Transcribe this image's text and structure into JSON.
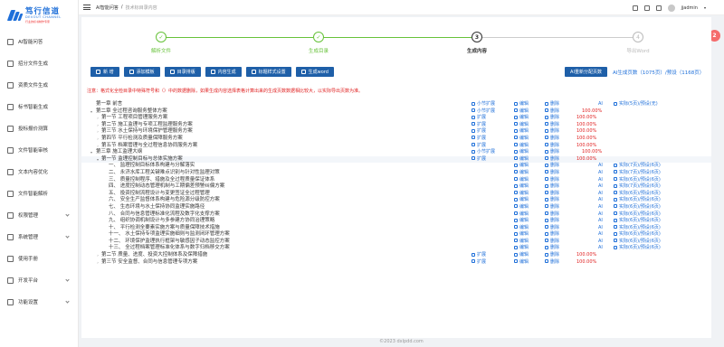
{
  "sidebar": {
    "logo": {
      "cn": "笃行信道",
      "en": "DEVOUT CHANNEL",
      "sub": "行业的标书制作专家"
    },
    "items": [
      {
        "label": "AI智能问答",
        "expand": false
      },
      {
        "label": "招分文件生成",
        "expand": false
      },
      {
        "label": "资质文件生成",
        "expand": false
      },
      {
        "label": "标书智能生成",
        "expand": false
      },
      {
        "label": "投标报价测算",
        "expand": false
      },
      {
        "label": "文件智能审核",
        "expand": false
      },
      {
        "label": "文本内容优化",
        "expand": false
      },
      {
        "label": "文件智能解析",
        "expand": false
      },
      {
        "label": "权限管理",
        "expand": true
      },
      {
        "label": "系统管理",
        "expand": true
      },
      {
        "label": "使用手册",
        "expand": false
      },
      {
        "label": "开发平台",
        "expand": true
      },
      {
        "label": "功能设置",
        "expand": true
      }
    ]
  },
  "topbar": {
    "breadcrumb": [
      "AI智能问答",
      "技术标目录内容"
    ],
    "username": "jjadmin",
    "corner_badge": "2"
  },
  "steps": [
    {
      "num": "✓",
      "label": "解析文件",
      "state": "done"
    },
    {
      "num": "✓",
      "label": "生成目录",
      "state": "done"
    },
    {
      "num": "3",
      "label": "生成内容",
      "state": "cur"
    },
    {
      "num": "4",
      "label": "导出Word",
      "state": "todo"
    }
  ],
  "toolbar": {
    "buttons": [
      "新 增",
      "添加模板",
      "目录排版",
      "内容生成",
      "标题样式设置",
      "生成word"
    ],
    "pages_button": "AI重新分配页数",
    "page_count": "AI生成页数（1075页）/预设（1168页）"
  },
  "notice": "注意：格式化全检目录中特殊符号和（）中的数据删除，如果生成内容选择表格计算出来的生成页数数据相比较大，以实际导出页数为准。",
  "labels": {
    "sub_expand": "小节扩展",
    "expand": "扩展",
    "edit": "编辑",
    "delete": "删除",
    "ai": "AI"
  },
  "tree": [
    {
      "text": "第一章 前言",
      "lvl": 0,
      "tog": "",
      "ops": "sub",
      "ai": true,
      "pct": "",
      "link": "实际(5页)/预设(无)"
    },
    {
      "text": "第二章 全过程咨询服务整体方案",
      "lvl": 0,
      "tog": "▾",
      "ops": "sub",
      "ai": false,
      "pct": "100.00%",
      "link": ""
    },
    {
      "text": "第一节 工程项目管理服务方案",
      "lvl": 1,
      "tog": "›",
      "ops": "exp",
      "ai": false,
      "pct": "100.00%",
      "link": ""
    },
    {
      "text": "第二节 施工监理与专项工程监理服务方案",
      "lvl": 1,
      "tog": "›",
      "ops": "exp",
      "ai": false,
      "pct": "100.00%",
      "link": ""
    },
    {
      "text": "第三节 水土保持与环境保护管理服务方案",
      "lvl": 1,
      "tog": "›",
      "ops": "exp",
      "ai": false,
      "pct": "100.00%",
      "link": ""
    },
    {
      "text": "第四节 平行检测及质量保障服务方案",
      "lvl": 1,
      "tog": "›",
      "ops": "exp",
      "ai": false,
      "pct": "100.00%",
      "link": ""
    },
    {
      "text": "第五节 档案管理与全过程信息协同服务方案",
      "lvl": 1,
      "tog": "›",
      "ops": "exp",
      "ai": false,
      "pct": "100.00%",
      "link": ""
    },
    {
      "text": "第三章 施工监理大纲",
      "lvl": 0,
      "tog": "▾",
      "ops": "sub",
      "ai": false,
      "pct": "100.00%",
      "link": ""
    },
    {
      "text": "第一节 监理控制目标与总体实施方案",
      "lvl": 1,
      "tog": "▾",
      "ops": "exp",
      "ai": false,
      "pct": "100.00%",
      "link": "",
      "hl": true
    },
    {
      "text": "一、 监理控制目标体系构建与分解落实",
      "lvl": 2,
      "tog": "",
      "ops": "none",
      "ai": true,
      "pct": "",
      "link": "实际(7页)/预设(6页)"
    },
    {
      "text": "二、 永济水库工程关键难点识别与针对性监理对策",
      "lvl": 2,
      "tog": "",
      "ops": "none",
      "ai": true,
      "pct": "",
      "link": "实际(7页)/预设(6页)"
    },
    {
      "text": "三、 质量控制程序、措施及全过程质量保证体系",
      "lvl": 2,
      "tog": "",
      "ops": "none",
      "ai": true,
      "pct": "",
      "link": "实际(6页)/预设(6页)"
    },
    {
      "text": "四、 进度控制动态管理机制与工期偏差预警纠偏方案",
      "lvl": 2,
      "tog": "",
      "ops": "none",
      "ai": true,
      "pct": "",
      "link": "实际(7页)/预设(6页)"
    },
    {
      "text": "五、 投资控制流程设计与变更签证全过程管理",
      "lvl": 2,
      "tog": "",
      "ops": "none",
      "ai": true,
      "pct": "",
      "link": "实际(6页)/预设(6页)"
    },
    {
      "text": "六、 安全生产监督体系构建与危险源分级防控方案",
      "lvl": 2,
      "tog": "",
      "ops": "none",
      "ai": true,
      "pct": "",
      "link": "实际(6页)/预设(6页)"
    },
    {
      "text": "七、 生态环境与水土保持协同监理实施路径",
      "lvl": 2,
      "tog": "",
      "ops": "none",
      "ai": true,
      "pct": "",
      "link": "实际(6页)/预设(6页)"
    },
    {
      "text": "八、 合同与信息管理标准化流程及数字化支撑方案",
      "lvl": 2,
      "tog": "",
      "ops": "none",
      "ai": true,
      "pct": "",
      "link": "实际(6页)/预设(6页)"
    },
    {
      "text": "九、 组织协调机制设计与多参建方协同治理策略",
      "lvl": 2,
      "tog": "",
      "ops": "none",
      "ai": true,
      "pct": "",
      "link": "实际(6页)/预设(6页)"
    },
    {
      "text": "十、 平行检测全要素实施方案与质量保障技术措施",
      "lvl": 2,
      "tog": "",
      "ops": "none",
      "ai": true,
      "pct": "",
      "link": "实际(6页)/预设(6页)"
    },
    {
      "text": "十一、 水土保持专项监理实施细则与监测闭环管理方案",
      "lvl": 2,
      "tog": "",
      "ops": "none",
      "ai": true,
      "pct": "",
      "link": "实际(6页)/预设(6页)"
    },
    {
      "text": "十二、 环境保护监理执行框架与敏感因子动态监控方案",
      "lvl": 2,
      "tog": "",
      "ops": "none",
      "ai": true,
      "pct": "",
      "link": "实际(6页)/预设(6页)"
    },
    {
      "text": "十三、 全过程档案管理标准化体系与数字归档移交方案",
      "lvl": 2,
      "tog": "",
      "ops": "none",
      "ai": true,
      "pct": "",
      "link": "实际(6页)/预设(6页)"
    },
    {
      "text": "第二节 质量、进度、投资大控制体系及保障措施",
      "lvl": 1,
      "tog": "›",
      "ops": "exp",
      "ai": false,
      "pct": "100.00%",
      "link": ""
    },
    {
      "text": "第三节 安全监督、合同与信息管理专项方案",
      "lvl": 1,
      "tog": "›",
      "ops": "exp",
      "ai": false,
      "pct": "100.00%",
      "link": ""
    }
  ],
  "footer": "©2023 dxlpdd.com",
  "colors": {
    "primary": "#1e5fa8",
    "link": "#1e6fd9",
    "done": "#67c23a",
    "danger": "#e02020",
    "badge": "#f56c6c"
  }
}
